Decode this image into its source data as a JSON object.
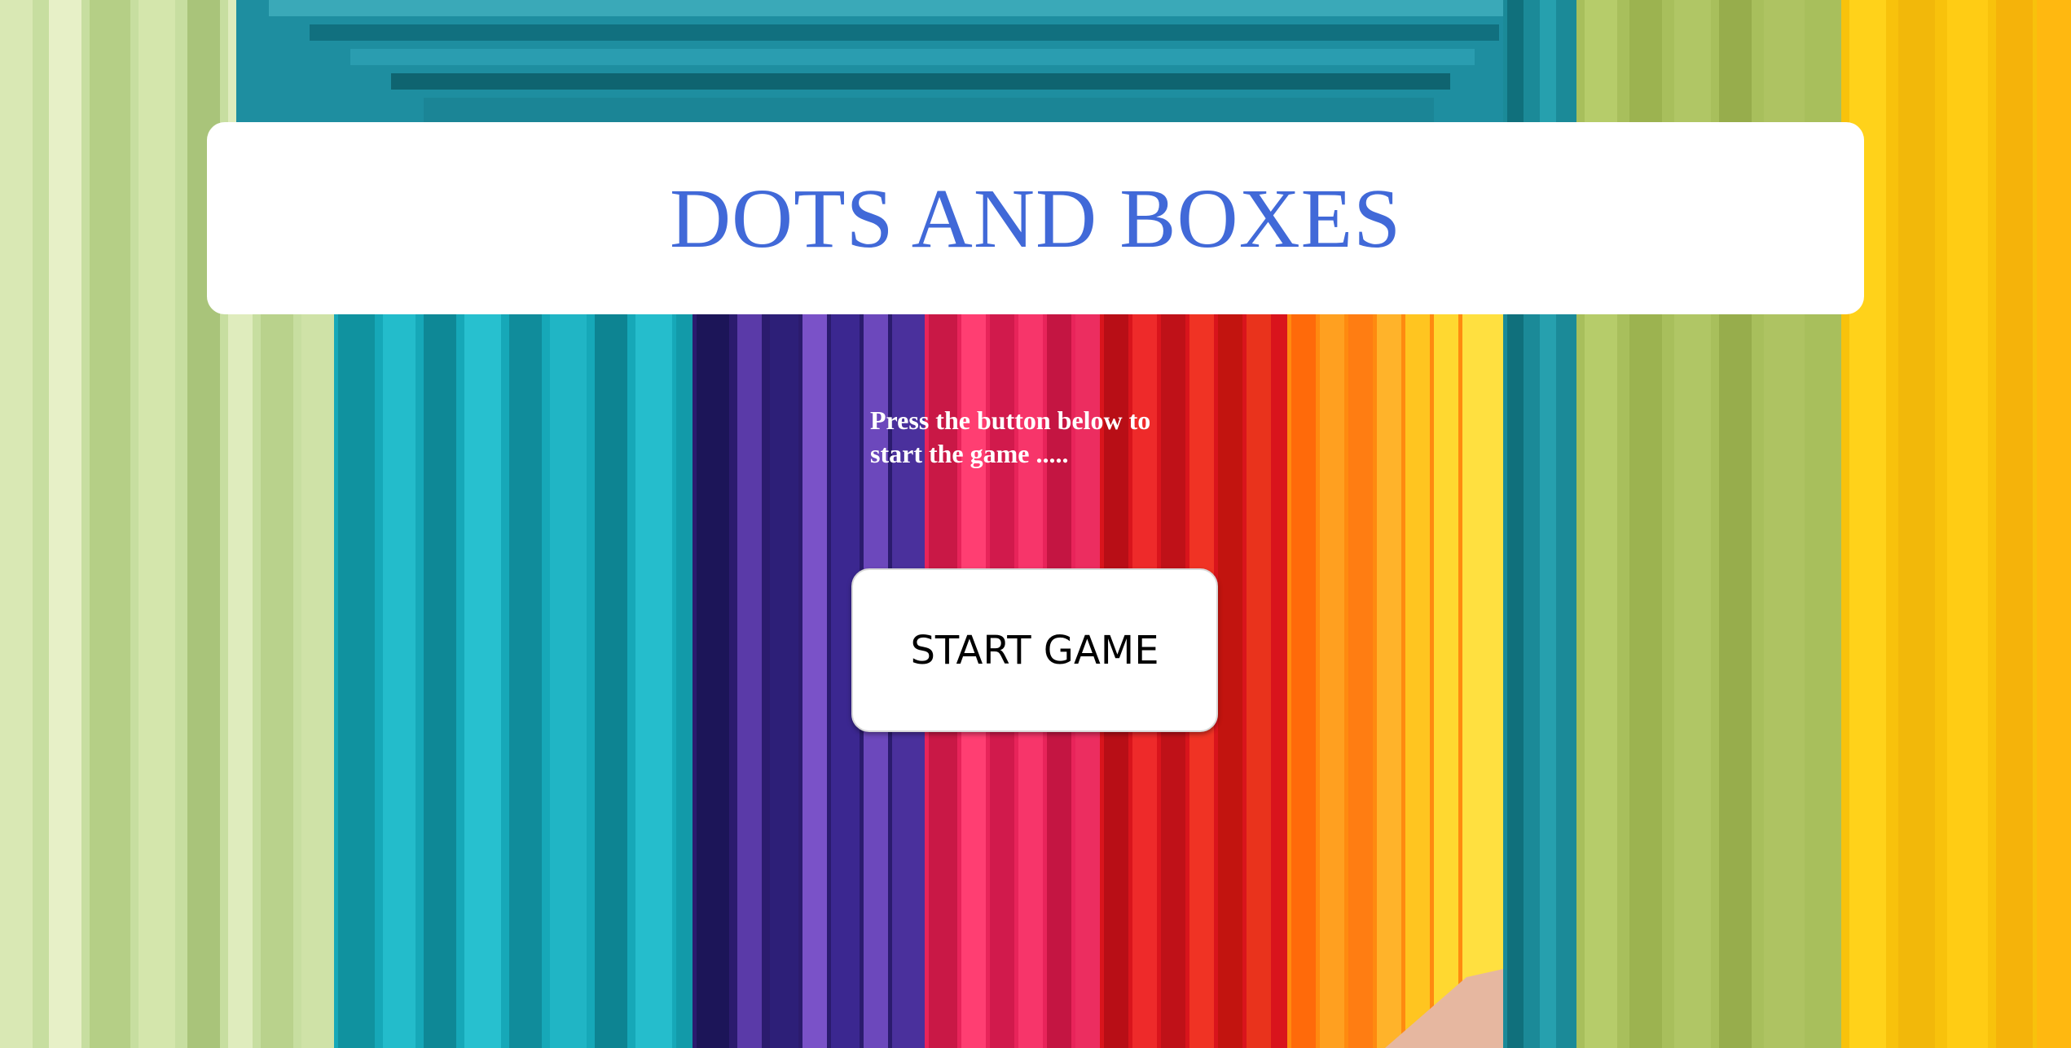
{
  "app": {
    "title": "DOTS AND BOXES",
    "instruction_text": "Press the button below to start the game .....",
    "start_button_label": "START GAME"
  },
  "colors": {
    "title_color": "#4169d8",
    "banner_background": "#ffffff",
    "instruction_color": "#ffffff",
    "button_background": "#ffffff",
    "button_text_color": "#000000"
  },
  "background": {
    "description_icon": "rainbow-corridor-image"
  }
}
